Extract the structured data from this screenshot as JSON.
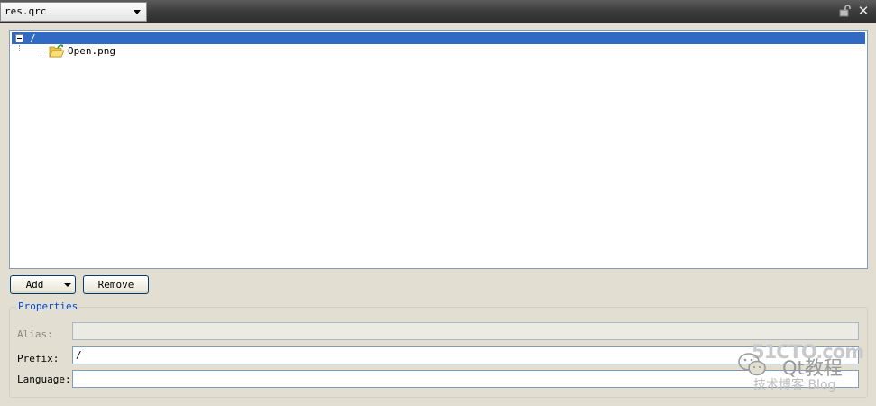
{
  "titlebar": {
    "file_combo_value": "res.qrc",
    "icons": [
      "lock-icon",
      "close-icon"
    ],
    "close_glyph": "✕"
  },
  "tree": {
    "root": {
      "label": "/",
      "expanded": true,
      "selected": true
    },
    "children": [
      {
        "label": "Open.png",
        "icon": "folder-open-icon"
      }
    ]
  },
  "buttons": {
    "add_label": "Add",
    "remove_label": "Remove"
  },
  "properties": {
    "title": "Properties",
    "alias_label": "Alias:",
    "alias_value": "",
    "prefix_label": "Prefix:",
    "prefix_value": "/",
    "language_label": "Language:",
    "language_value": ""
  },
  "watermark": {
    "site": "51CTO.com",
    "name": "Qt教程",
    "blog": "技术博客 Blog"
  },
  "colors": {
    "selection": "#316ac5",
    "window_bg": "#e2dfd2",
    "group_title": "#0046d5"
  }
}
